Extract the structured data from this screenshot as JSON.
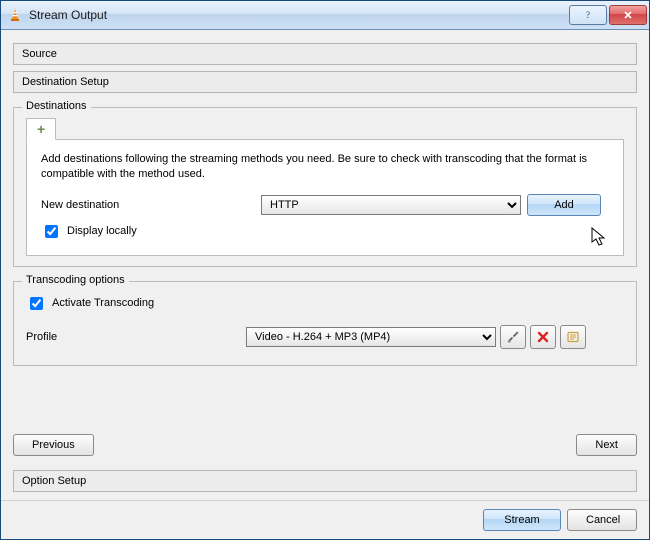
{
  "window": {
    "title": "Stream Output"
  },
  "sections": {
    "source": "Source",
    "destination_setup": "Destination Setup",
    "option_setup": "Option Setup"
  },
  "destinations": {
    "legend": "Destinations",
    "hint": "Add destinations following the streaming methods you need. Be sure to check with transcoding that the format is compatible with the method used.",
    "new_destination_label": "New destination",
    "method_selected": "HTTP",
    "add_label": "Add",
    "display_locally_label": "Display locally",
    "display_locally_checked": true
  },
  "transcoding": {
    "legend": "Transcoding options",
    "activate_label": "Activate Transcoding",
    "activate_checked": true,
    "profile_label": "Profile",
    "profile_selected": "Video - H.264 + MP3 (MP4)"
  },
  "nav": {
    "previous": "Previous",
    "next": "Next"
  },
  "dialog": {
    "stream": "Stream",
    "cancel": "Cancel"
  },
  "icons": {
    "app": "vlc-cone-icon",
    "help": "help-icon",
    "close": "close-icon",
    "plus": "plus-icon",
    "tools": "tools-icon",
    "delete": "delete-icon",
    "save": "save-profile-icon"
  }
}
